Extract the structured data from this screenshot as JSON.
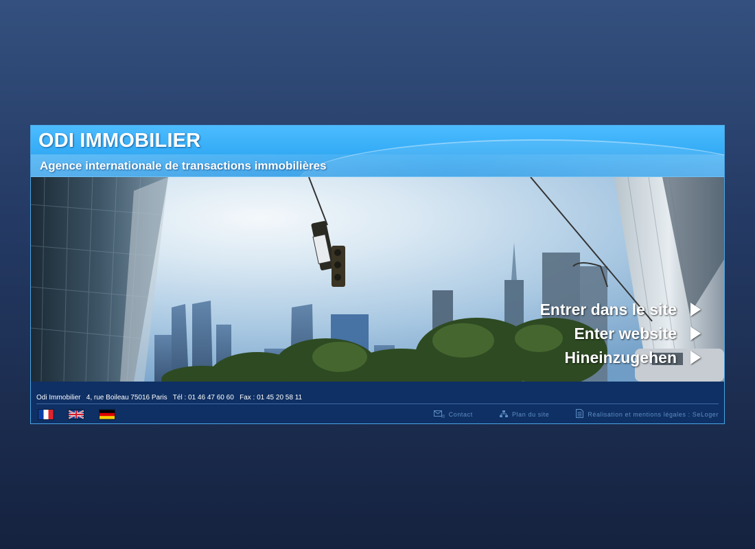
{
  "header": {
    "title": "ODI IMMOBILIER",
    "subtitle": "Agence internationale de transactions immobilières"
  },
  "hero": {
    "image": "city-skyline-photo",
    "entry_links": [
      {
        "label": "Entrer dans le site",
        "icon": "arrow-right-icon"
      },
      {
        "label": "Enter website",
        "icon": "arrow-right-icon"
      },
      {
        "label": "Hineinzugehen",
        "icon": "arrow-right-icon"
      }
    ]
  },
  "footer": {
    "address": "Odi Immobilier   4, rue Boileau 75016 Paris   Tél : 01 46 47 60 60   Fax : 01 45 20 58 11",
    "languages": [
      {
        "code": "fr",
        "icon": "flag-france-icon"
      },
      {
        "code": "en",
        "icon": "flag-uk-icon"
      },
      {
        "code": "de",
        "icon": "flag-germany-icon"
      }
    ],
    "links": [
      {
        "label": "Contact",
        "icon": "mail-icon"
      },
      {
        "label": "Plan du site",
        "icon": "sitemap-icon"
      },
      {
        "label": "Réalisation et mentions légales : SeLoger",
        "icon": "document-icon"
      }
    ]
  },
  "colors": {
    "background_top": "#34507e",
    "background_bottom": "#15223f",
    "header_blue": "#37aef7",
    "footer_blue": "#0f3064",
    "footer_link": "#5d8fc6"
  }
}
